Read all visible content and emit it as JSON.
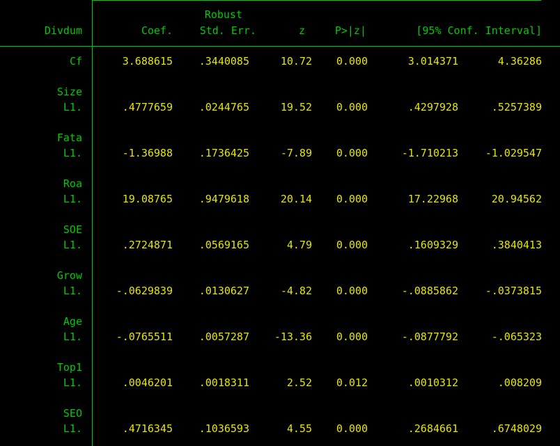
{
  "table": {
    "depvar": "Divdum",
    "header_top": {
      "se": "Robust"
    },
    "columns": {
      "coef": "Coef.",
      "se": "Std. Err.",
      "z": "z",
      "p": "P>|z|",
      "ci": "[95% Conf. Interval]"
    },
    "rows": [
      {
        "var": "Cf",
        "op": "",
        "coef": "3.688615",
        "se": ".3440085",
        "z": "10.72",
        "p": "0.000",
        "lo": "3.014371",
        "hi": "4.36286"
      },
      {
        "var": "Size",
        "op": "L1.",
        "coef": ".4777659",
        "se": ".0244765",
        "z": "19.52",
        "p": "0.000",
        "lo": ".4297928",
        "hi": ".5257389"
      },
      {
        "var": "Fata",
        "op": "L1.",
        "coef": "-1.36988",
        "se": ".1736425",
        "z": "-7.89",
        "p": "0.000",
        "lo": "-1.710213",
        "hi": "-1.029547"
      },
      {
        "var": "Roa",
        "op": "L1.",
        "coef": "19.08765",
        "se": ".9479618",
        "z": "20.14",
        "p": "0.000",
        "lo": "17.22968",
        "hi": "20.94562"
      },
      {
        "var": "SOE",
        "op": "L1.",
        "coef": ".2724871",
        "se": ".0569165",
        "z": "4.79",
        "p": "0.000",
        "lo": ".1609329",
        "hi": ".3840413"
      },
      {
        "var": "Grow",
        "op": "L1.",
        "coef": "-.0629839",
        "se": ".0130627",
        "z": "-4.82",
        "p": "0.000",
        "lo": "-.0885862",
        "hi": "-.0373815"
      },
      {
        "var": "Age",
        "op": "L1.",
        "coef": "-.0765511",
        "se": ".0057287",
        "z": "-13.36",
        "p": "0.000",
        "lo": "-.0877792",
        "hi": "-.065323"
      },
      {
        "var": "Top1",
        "op": "L1.",
        "coef": ".0046201",
        "se": ".0018311",
        "z": "2.52",
        "p": "0.012",
        "lo": ".0010312",
        "hi": ".008209"
      },
      {
        "var": "SEO",
        "op": "L1.",
        "coef": ".4716345",
        "se": ".1036593",
        "z": "4.55",
        "p": "0.000",
        "lo": ".2684661",
        "hi": ".6748029"
      }
    ]
  }
}
